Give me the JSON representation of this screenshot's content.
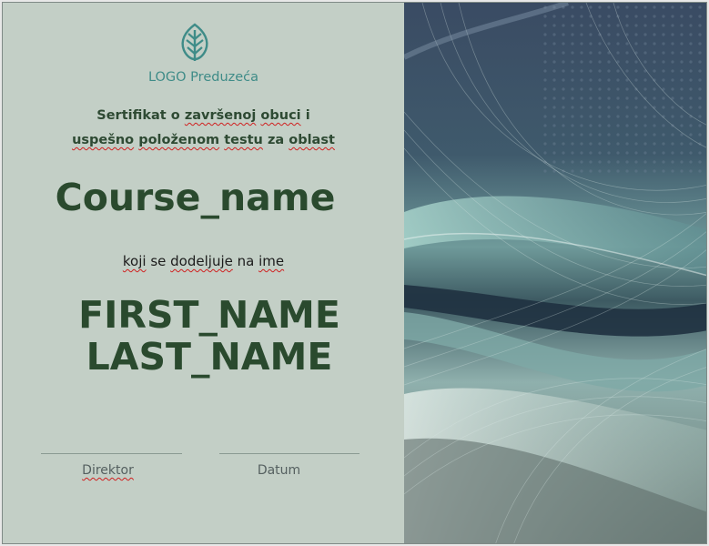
{
  "logo": {
    "text": "LOGO Preduzeća",
    "icon": "leaf-icon",
    "accent": "#3f8c88"
  },
  "certificate": {
    "intro_line1": {
      "w1": "Sertifikat",
      "w2": "o",
      "w3": "završenoj",
      "w4": "obuci",
      "w5": "i"
    },
    "intro_line2": {
      "w1": "uspešno",
      "w2": "položenom",
      "w3": "testu",
      "w4": "za",
      "w5": "oblast"
    },
    "course_name": "Course_name",
    "awarded_to": {
      "w1": "koji",
      "w2": "se",
      "w3": "dodeljuje",
      "w4": "na",
      "w5": "ime"
    },
    "first_name": "FIRST_NAME",
    "last_name": "LAST_NAME"
  },
  "signatures": {
    "director_label": "Direktor",
    "date_label": "Datum"
  },
  "colors": {
    "panel_bg": "#c3cfc6",
    "title_green": "#2a4a2e",
    "spellcheck_underline": "#d02020"
  }
}
